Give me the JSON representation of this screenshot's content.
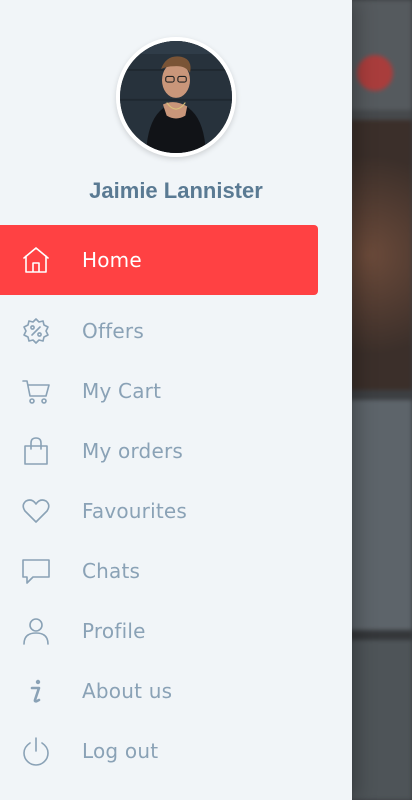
{
  "profile": {
    "name": "Jaimie Lannister"
  },
  "menu": {
    "items": [
      {
        "label": "Home",
        "icon": "home-icon",
        "active": true
      },
      {
        "label": "Offers",
        "icon": "offer-badge-icon",
        "active": false
      },
      {
        "label": "My Cart",
        "icon": "cart-icon",
        "active": false
      },
      {
        "label": "My orders",
        "icon": "shopping-bag-icon",
        "active": false
      },
      {
        "label": "Favourites",
        "icon": "heart-icon",
        "active": false
      },
      {
        "label": "Chats",
        "icon": "chat-bubble-icon",
        "active": false
      },
      {
        "label": "Profile",
        "icon": "user-icon",
        "active": false
      },
      {
        "label": "About us",
        "icon": "info-icon",
        "active": false
      },
      {
        "label": "Log out",
        "icon": "power-icon",
        "active": false
      }
    ]
  },
  "colors": {
    "drawer_bg": "#f1f5f8",
    "active_bg": "#ff4143",
    "text": "#8aa2b6",
    "name_text": "#5a7a93"
  }
}
